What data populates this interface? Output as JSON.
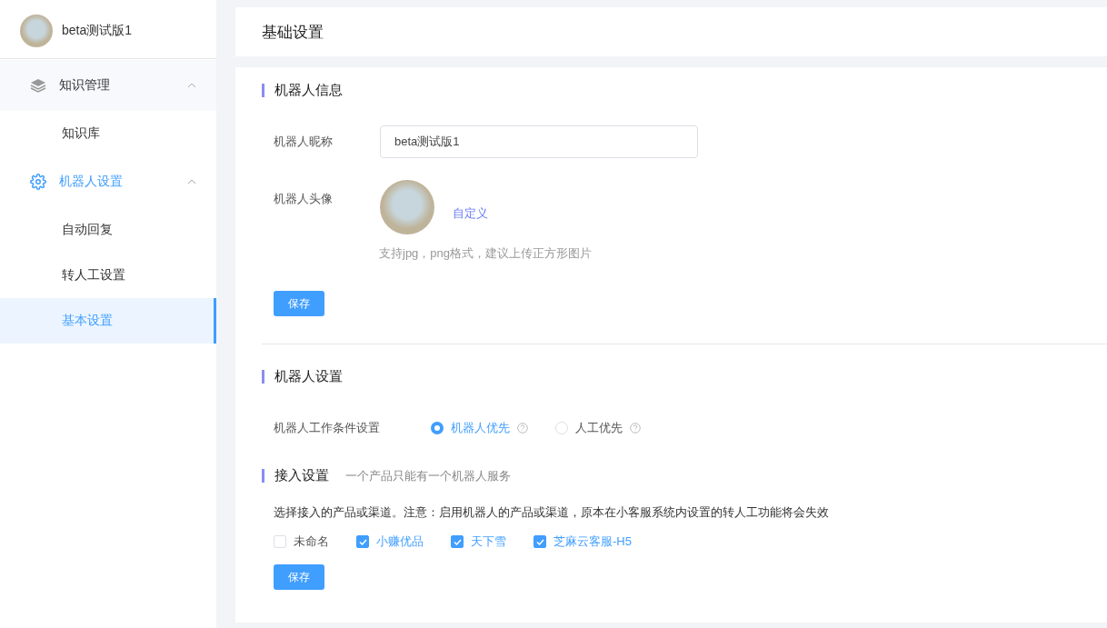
{
  "sidebar": {
    "bot_name": "beta测试版1",
    "groups": [
      {
        "label": "知识管理",
        "expanded": true,
        "active": false,
        "children": [
          {
            "label": "知识库",
            "selected": false
          }
        ]
      },
      {
        "label": "机器人设置",
        "expanded": true,
        "active": true,
        "children": [
          {
            "label": "自动回复",
            "selected": false
          },
          {
            "label": "转人工设置",
            "selected": false
          },
          {
            "label": "基本设置",
            "selected": true
          }
        ]
      }
    ]
  },
  "page_title": "基础设置",
  "bot_info": {
    "title": "机器人信息",
    "nickname_label": "机器人昵称",
    "nickname_value": "beta测试版1",
    "avatar_label": "机器人头像",
    "customize_link": "自定义",
    "avatar_hint": "支持jpg，png格式，建议上传正方形图片",
    "save": "保存"
  },
  "bot_settings": {
    "title": "机器人设置",
    "condition_label": "机器人工作条件设置",
    "options": [
      {
        "label": "机器人优先",
        "selected": true
      },
      {
        "label": "人工优先",
        "selected": false
      }
    ]
  },
  "access": {
    "title": "接入设置",
    "subtitle": "一个产品只能有一个机器人服务",
    "note": "选择接入的产品或渠道。注意：启用机器人的产品或渠道，原本在小客服系统内设置的转人工功能将会失效",
    "channels": [
      {
        "label": "未命名",
        "checked": false
      },
      {
        "label": "小赚优品",
        "checked": true
      },
      {
        "label": "天下雪",
        "checked": true
      },
      {
        "label": "芝麻云客服-H5",
        "checked": true
      }
    ],
    "save": "保存"
  }
}
